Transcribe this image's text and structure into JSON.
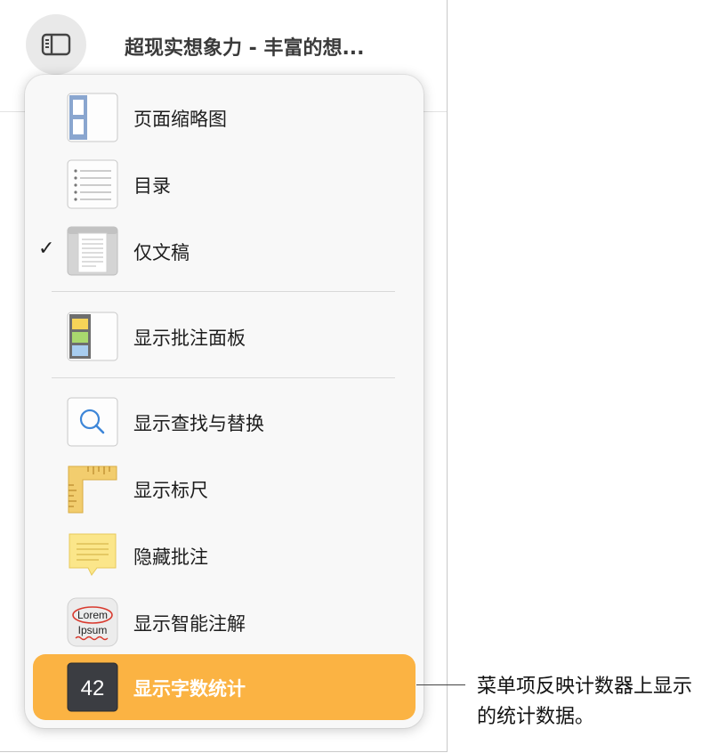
{
  "window": {
    "title": "超现实想象力 - 丰富的想...",
    "sidebar_button_icon": "sidebar-icon"
  },
  "menu": {
    "items": [
      {
        "label": "页面缩略图",
        "icon": "page-thumbnails-icon",
        "checked": false,
        "highlighted": false
      },
      {
        "label": "目录",
        "icon": "table-of-contents-icon",
        "checked": false,
        "highlighted": false
      },
      {
        "label": "仅文稿",
        "icon": "document-only-icon",
        "checked": true,
        "highlighted": false,
        "check_mark": "✓"
      },
      {
        "label": "显示批注面板",
        "icon": "comments-pane-icon",
        "checked": false,
        "highlighted": false
      },
      {
        "label": "显示查找与替换",
        "icon": "find-replace-icon",
        "checked": false,
        "highlighted": false
      },
      {
        "label": "显示标尺",
        "icon": "ruler-icon",
        "checked": false,
        "highlighted": false
      },
      {
        "label": "隐藏批注",
        "icon": "comment-note-icon",
        "checked": false,
        "highlighted": false
      },
      {
        "label": "显示智能注解",
        "icon": "smart-annotations-icon",
        "checked": false,
        "highlighted": false,
        "icon_text_1": "Lorem",
        "icon_text_2": "Ipsum"
      },
      {
        "label": "显示字数统计",
        "icon": "word-count-icon",
        "checked": false,
        "highlighted": true,
        "icon_text": "42"
      }
    ]
  },
  "callout": {
    "text": "菜单项反映计数器上显示的统计数据。"
  },
  "colors": {
    "highlight": "#fbb343",
    "menu_background": "#f8f8f8"
  }
}
